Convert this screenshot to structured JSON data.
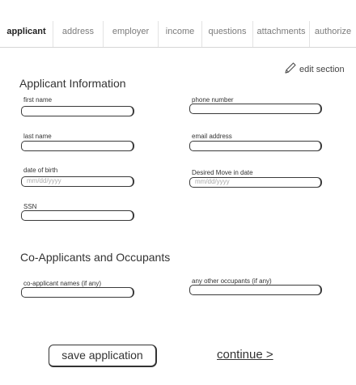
{
  "tabs": [
    {
      "label": "applicant",
      "active": true
    },
    {
      "label": "address",
      "active": false
    },
    {
      "label": "employer",
      "active": false
    },
    {
      "label": "income",
      "active": false
    },
    {
      "label": "questions",
      "active": false
    },
    {
      "label": "attachments",
      "active": false
    },
    {
      "label": "authorize",
      "active": false
    }
  ],
  "edit_section": {
    "label": "edit section",
    "icon": "pencil-icon"
  },
  "applicant_info": {
    "heading": "Applicant Information",
    "first_name": {
      "label": "first name",
      "value": "",
      "placeholder": ""
    },
    "phone_number": {
      "label": "phone number",
      "value": "",
      "placeholder": ""
    },
    "last_name": {
      "label": "last name",
      "value": "",
      "placeholder": ""
    },
    "email_address": {
      "label": "email address",
      "value": "",
      "placeholder": ""
    },
    "date_of_birth": {
      "label": "date of birth",
      "value": "",
      "placeholder": "mm/dd/yyyy"
    },
    "move_in_date": {
      "label": "Desired Move in date",
      "value": "",
      "placeholder": "mm/dd/yyyy"
    },
    "ssn": {
      "label": "SSN",
      "value": "",
      "placeholder": ""
    }
  },
  "co_applicants": {
    "heading": "Co-Applicants and Occupants",
    "names": {
      "label": "co-applicant names (if any)",
      "value": "",
      "placeholder": ""
    },
    "occupants": {
      "label": "any other occupants (if any)",
      "value": "",
      "placeholder": ""
    }
  },
  "actions": {
    "save_label": "save application",
    "continue_label": "continue >"
  }
}
